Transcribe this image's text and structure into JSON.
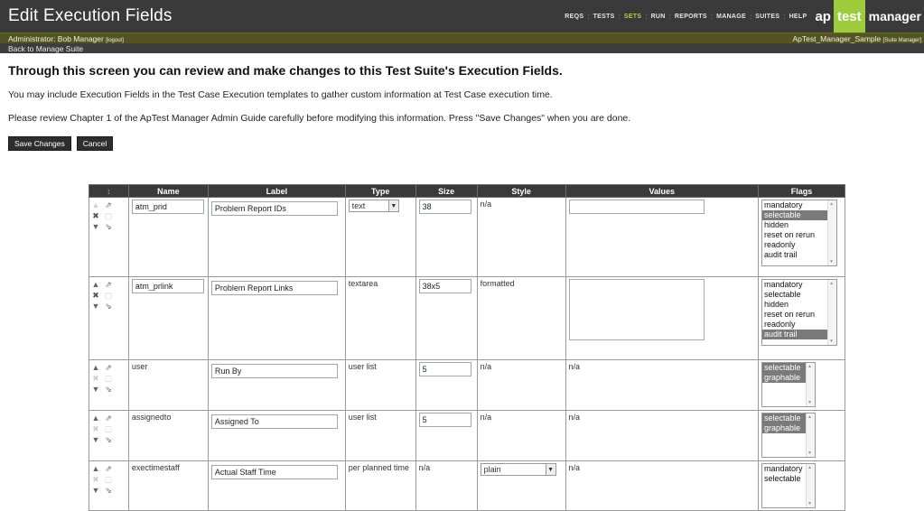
{
  "header": {
    "title": "Edit Execution Fields",
    "nav": [
      {
        "label": "REQS",
        "active": false
      },
      {
        "label": "TESTS",
        "active": false
      },
      {
        "label": "SETS",
        "active": true
      },
      {
        "label": "RUN",
        "active": false
      },
      {
        "label": "REPORTS",
        "active": false
      },
      {
        "label": "MANAGE",
        "active": false
      },
      {
        "label": "SUITES",
        "active": false
      },
      {
        "label": "HELP",
        "active": false
      }
    ],
    "logo": {
      "ap": "ap",
      "test": "test",
      "manager": "manager"
    }
  },
  "subbar": {
    "user": "Administrator: Bob Manager",
    "logout": "[logout]",
    "project": "ApTest_Manager_Sample",
    "project_tag": "[Suite Manager]"
  },
  "backlink": "Back to Manage Suite",
  "intro": {
    "title": "Through this screen you can review and make changes to this Test Suite's Execution Fields.",
    "p1": "You may include Execution Fields in the Test Case Execution templates to gather custom information at Test Case execution time.",
    "p2": "Please review Chapter 1 of the ApTest Manager Admin Guide carefully before modifying this information. Press \"Save Changes\" when you are done."
  },
  "buttons": {
    "save": "Save Changes",
    "cancel": "Cancel"
  },
  "table": {
    "headers": [
      "Name",
      "Label",
      "Type",
      "Size",
      "Style",
      "Values",
      "Flags"
    ],
    "rows": [
      {
        "name": "atm_prid",
        "label": "Problem Report IDs",
        "type": "text",
        "size": "38",
        "style": "n/a",
        "values": "",
        "flags": [
          {
            "t": "mandatory",
            "s": false
          },
          {
            "t": "selectable",
            "s": true
          },
          {
            "t": "hidden",
            "s": false
          },
          {
            "t": "reset on rerun",
            "s": false
          },
          {
            "t": "readonly",
            "s": false
          },
          {
            "t": "audit trail",
            "s": false
          }
        ]
      },
      {
        "name": "atm_prlink",
        "label": "Problem Report Links",
        "type": "textarea",
        "size": "38x5",
        "style": "formatted",
        "values": "",
        "flags": [
          {
            "t": "mandatory",
            "s": false
          },
          {
            "t": "selectable",
            "s": false
          },
          {
            "t": "hidden",
            "s": false
          },
          {
            "t": "reset on rerun",
            "s": false
          },
          {
            "t": "readonly",
            "s": false
          },
          {
            "t": "audit trail",
            "s": true
          }
        ]
      },
      {
        "name": "user",
        "label": "Run By",
        "type": "user list",
        "size": "5",
        "style": "n/a",
        "values": "n/a",
        "flags": [
          {
            "t": "selectable",
            "s": true
          },
          {
            "t": "graphable",
            "s": true
          }
        ]
      },
      {
        "name": "assignedto",
        "label": "Assigned To",
        "type": "user list",
        "size": "5",
        "style": "n/a",
        "values": "n/a",
        "flags": [
          {
            "t": "selectable",
            "s": true
          },
          {
            "t": "graphable",
            "s": true
          }
        ]
      },
      {
        "name": "exectimestaff",
        "label": "Actual Staff Time",
        "type": "per planned time",
        "size": "n/a",
        "style": "plain",
        "values": "n/a",
        "flags": [
          {
            "t": "mandatory",
            "s": false
          },
          {
            "t": "selectable",
            "s": false
          }
        ]
      }
    ]
  }
}
